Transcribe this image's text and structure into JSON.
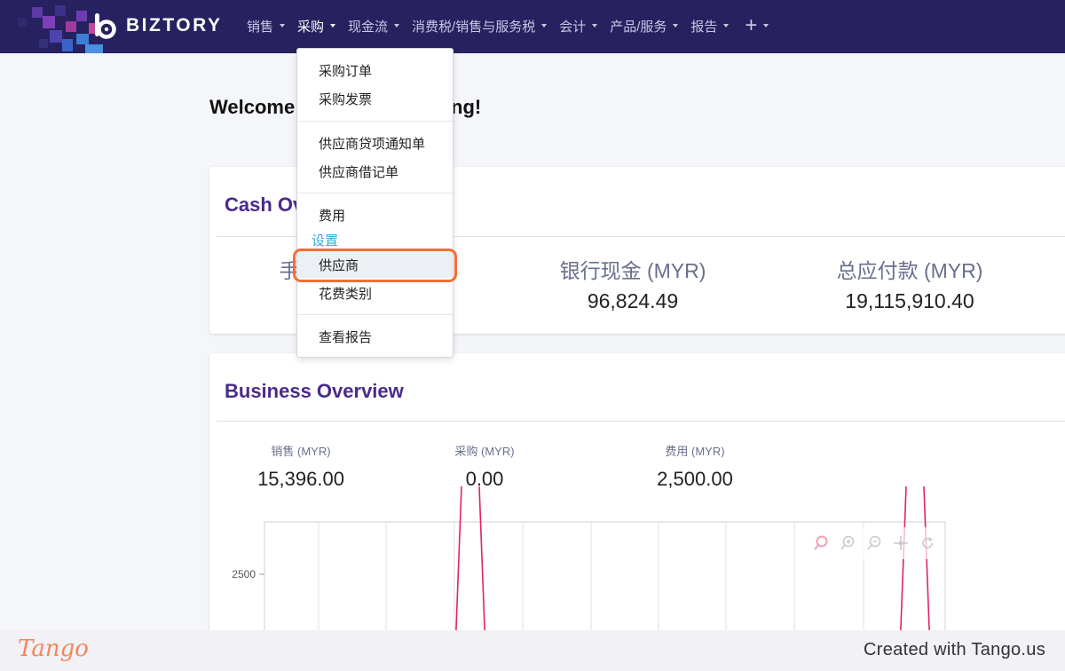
{
  "nav": {
    "brand": "BIZTORY",
    "items": [
      {
        "label": "销售"
      },
      {
        "label": "采购",
        "active": true
      },
      {
        "label": "现金流"
      },
      {
        "label": "消费税/销售与服务税"
      },
      {
        "label": "会计"
      },
      {
        "label": "产品/服务"
      },
      {
        "label": "报告"
      }
    ],
    "add_label": "+"
  },
  "welcome": {
    "head": "Welcome",
    "tail": "ng!"
  },
  "cash_overview": {
    "title": "Cash Ov",
    "partial_label": "手",
    "stats": [
      {
        "label": "银行现金 (MYR)",
        "value": "96,824.49"
      },
      {
        "label": "总应付款 (MYR)",
        "value": "19,115,910.40"
      }
    ]
  },
  "business_overview": {
    "title": "Business Overview",
    "stats": [
      {
        "label": "销售 (MYR)",
        "value": "15,396.00"
      },
      {
        "label": "采购 (MYR)",
        "value": "0.00"
      },
      {
        "label": "费用 (MYR)",
        "value": "2,500.00"
      }
    ]
  },
  "chart_data": {
    "type": "line",
    "y_ticks": [
      "2500"
    ],
    "series_color": "#e0245e",
    "series": [
      {
        "values": [
          null,
          4000,
          0,
          null,
          null,
          null,
          null,
          null,
          null,
          4000,
          0
        ]
      }
    ]
  },
  "chart_toolbar": [
    "zoom-select-icon",
    "zoom-in-icon",
    "zoom-out-icon",
    "pan-icon",
    "reset-icon"
  ],
  "dropdown": {
    "groups": [
      {
        "items": [
          "采购订单",
          "采购发票"
        ]
      },
      {
        "items": [
          "供应商贷项通知单",
          "供应商借记单"
        ]
      },
      {
        "items": [
          "费用"
        ]
      },
      {
        "header": "设置",
        "items": [
          "供应商",
          "花费类别"
        ]
      },
      {
        "items": [
          "查看报告"
        ]
      }
    ],
    "selected": "供应商"
  },
  "footer": {
    "brand": "Tango",
    "credit": "Created with Tango.us"
  },
  "colors": {
    "nav_bg": "#27215f",
    "title_purple": "#4a2a8c",
    "highlight": "#f36e36",
    "section_blue": "#3aa6d6"
  }
}
